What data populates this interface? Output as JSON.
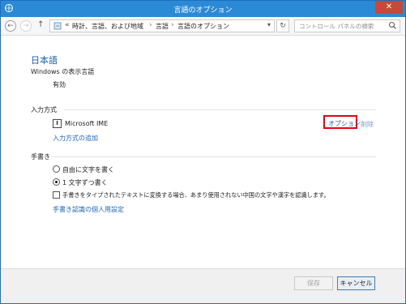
{
  "window": {
    "title": "言語のオプション",
    "close_label": "✕"
  },
  "addressbar": {
    "chevron": "«",
    "breadcrumbs": [
      "時計、言語、および地域",
      "言語",
      "言語のオプション"
    ],
    "search_placeholder": "コントロール パネルの検索"
  },
  "content": {
    "language_name": "日本語",
    "display_language": {
      "label": "Windows の表示言語",
      "status": "有効"
    },
    "input_method": {
      "label": "入力方式",
      "ime_name": "Microsoft IME",
      "options_link": "オプション",
      "delete_link": "削除",
      "add_link": "入力方式の追加"
    },
    "handwriting": {
      "label": "手書き",
      "option_free": "自由に文字を書く",
      "option_single": "1 文字ずつ書く",
      "checkbox_label": "手書きをタイプされたテキストに変換する場合、あまり使用されない中国の文字や漢字を認識します。",
      "personalize_link": "手書き認識の個人用設定"
    }
  },
  "footer": {
    "save_label": "保存",
    "cancel_label": "キャンセル"
  },
  "colors": {
    "titlebar": "#2b8ad6",
    "heading": "#1e5faa",
    "link": "#1e66b8",
    "highlight": "#e60012"
  }
}
